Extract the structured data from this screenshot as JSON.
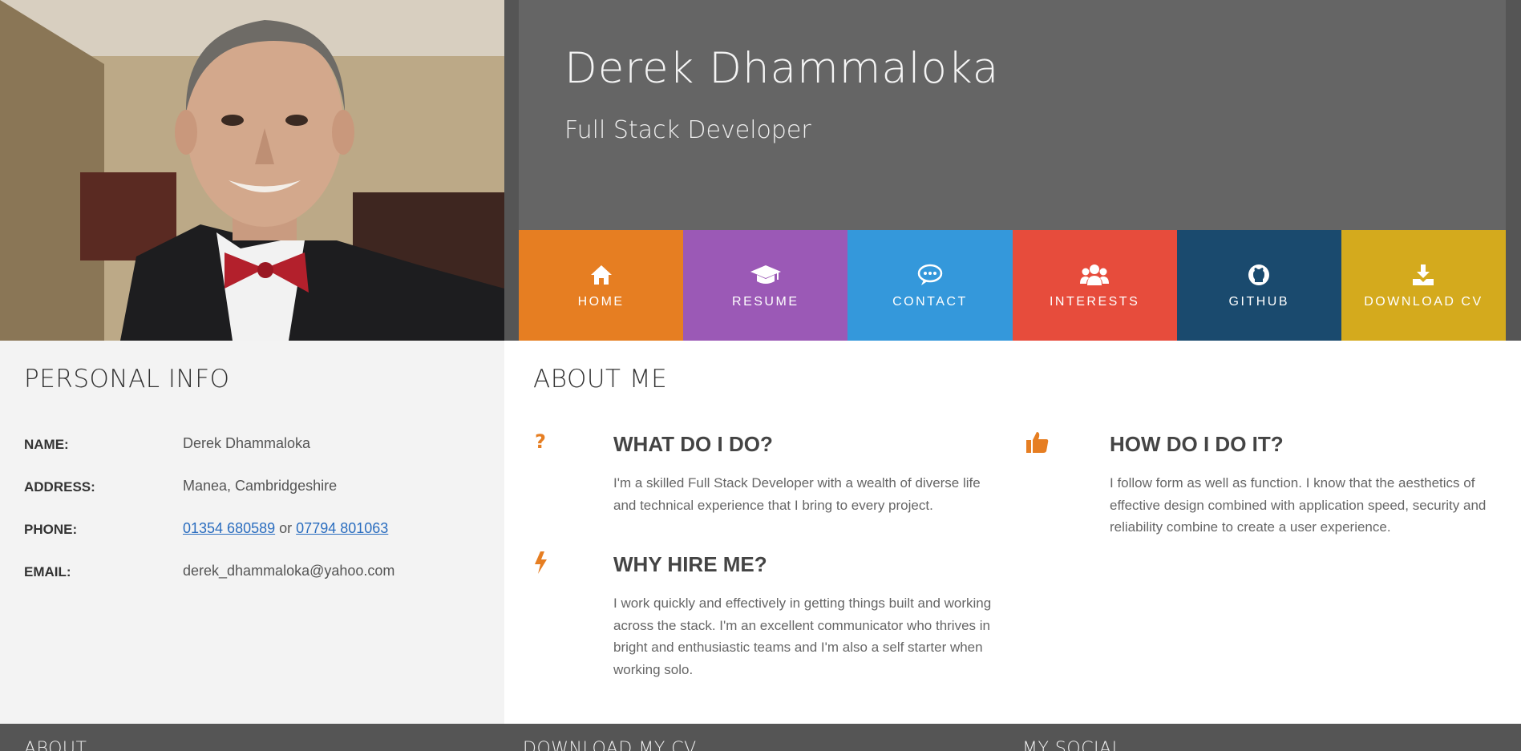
{
  "header": {
    "name": "Derek Dhammaloka",
    "role": "Full Stack Developer"
  },
  "nav": [
    {
      "label": "HOME",
      "icon": "home-icon",
      "color": "#e67e22"
    },
    {
      "label": "RESUME",
      "icon": "graduation-cap-icon",
      "color": "#9b59b6"
    },
    {
      "label": "CONTACT",
      "icon": "chat-bubble-icon",
      "color": "#3498db"
    },
    {
      "label": "INTERESTS",
      "icon": "users-icon",
      "color": "#e74c3c"
    },
    {
      "label": "GITHUB",
      "icon": "github-icon",
      "color": "#1a4a6e"
    },
    {
      "label": "DOWNLOAD CV",
      "icon": "download-icon",
      "color": "#d4aa1d"
    }
  ],
  "personal": {
    "title": "PERSONAL INFO",
    "name_key": "NAME:",
    "name_val": "Derek Dhammaloka",
    "address_key": "ADDRESS:",
    "address_val": "Manea, Cambridgeshire",
    "phone_key": "PHONE:",
    "phone_1": "01354 680589",
    "phone_sep": "or",
    "phone_2": "07794 801063",
    "email_key": "EMAIL:",
    "email_val": "derek_dhammaloka@yahoo.com"
  },
  "about": {
    "title": "ABOUT ME",
    "accent": "#e67e22",
    "what_title": "WHAT DO I DO?",
    "what_text": "I'm a skilled Full Stack Developer with a wealth of diverse life and technical experience that I bring to every project.",
    "how_title": "HOW DO I DO IT?",
    "how_text": "I follow form as well as function. I know that the aesthetics of effective design combined with application speed, security and reliability combine to create a user experience.",
    "why_title": "WHY HIRE ME?",
    "why_text": "I work quickly and effectively in getting things built and working across the stack. I'm an excellent communicator who thrives in bright and enthusiastic teams and I'm also a self starter when working solo."
  },
  "footer": {
    "about": "ABOUT",
    "download": "DOWNLOAD MY CV",
    "social": "MY SOCIAL"
  }
}
